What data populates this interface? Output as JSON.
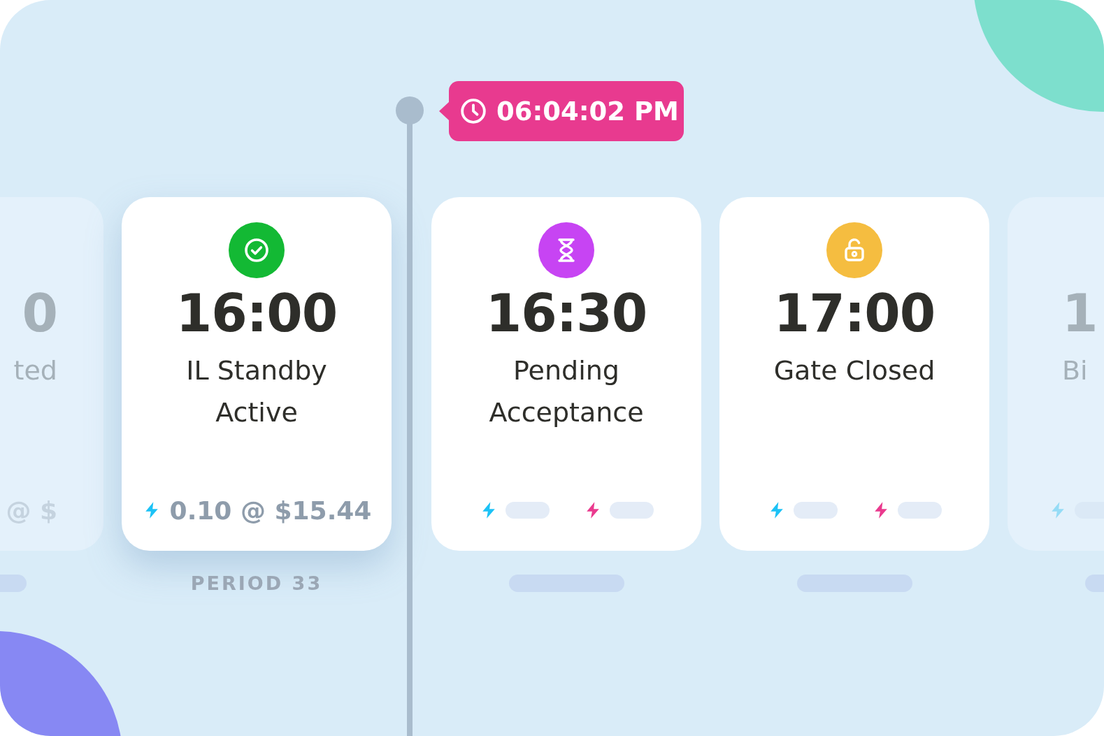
{
  "tooltip": {
    "time": "06:04:02 PM"
  },
  "cards": [
    {
      "kind": "partial_left",
      "selected": false,
      "time": "0",
      "label": "ted",
      "price": {
        "text": "@ $"
      }
    },
    {
      "kind": "full",
      "selected": true,
      "status": {
        "kind": "check",
        "color": "#13b934"
      },
      "time": "16:00",
      "label": "IL Standby\nActive",
      "price": {
        "text": "0.10 @ $15.44"
      },
      "period": "PERIOD 33"
    },
    {
      "kind": "full",
      "selected": false,
      "status": {
        "kind": "hourglass",
        "color": "#c744f3"
      },
      "time": "16:30",
      "label": "Pending\nAcceptance",
      "meters": [
        {
          "color": "#1cc2f6"
        },
        {
          "color": "#ea3a8e"
        }
      ]
    },
    {
      "kind": "full",
      "selected": false,
      "status": {
        "kind": "lock",
        "color": "#f5bd40"
      },
      "time": "17:00",
      "label": "Gate Closed",
      "meters": [
        {
          "color": "#1cc2f6"
        },
        {
          "color": "#ea3a8e"
        }
      ]
    },
    {
      "kind": "partial_right",
      "selected": false,
      "time": "1",
      "label": "Bi",
      "meters": [
        {
          "color": "#95dcf6"
        }
      ]
    }
  ]
}
